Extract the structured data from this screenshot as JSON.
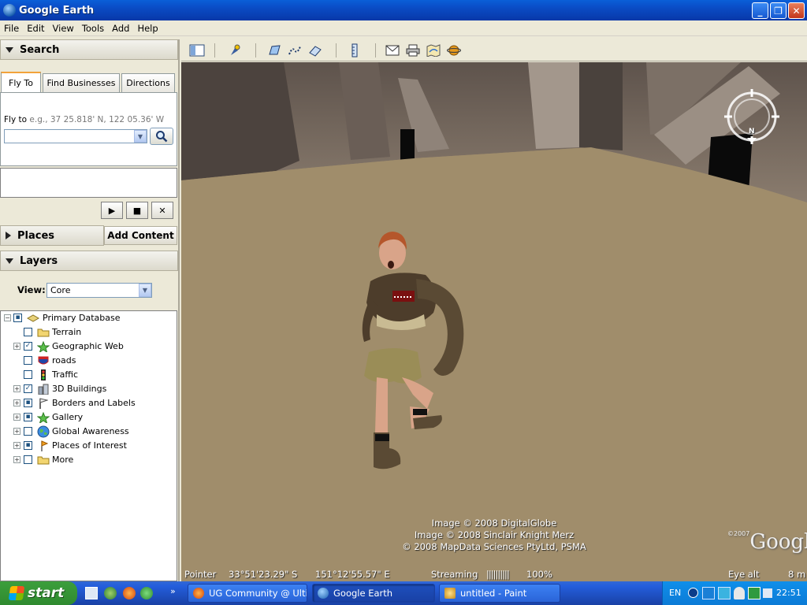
{
  "window": {
    "title": "Google Earth"
  },
  "menu": [
    "File",
    "Edit",
    "View",
    "Tools",
    "Add",
    "Help"
  ],
  "search": {
    "header": "Search",
    "tabs": [
      "Fly To",
      "Find Businesses",
      "Directions"
    ],
    "fly_to_label": "Fly to",
    "fly_to_example": "e.g., 37 25.818' N, 122 05.36' W",
    "fly_to_value": ""
  },
  "places": {
    "header": "Places",
    "add_content": "Add Content"
  },
  "layers": {
    "header": "Layers",
    "view_label": "View:",
    "view_value": "Core",
    "items": [
      {
        "label": "Primary Database",
        "checked": "partial",
        "expandable": true,
        "icon": "database-icon"
      },
      {
        "label": "Terrain",
        "checked": "unchecked",
        "expandable": false,
        "icon": "folder-icon"
      },
      {
        "label": "Geographic Web",
        "checked": "checked",
        "expandable": true,
        "icon": "star-icon"
      },
      {
        "label": "roads",
        "checked": "unchecked",
        "expandable": false,
        "icon": "road-sign-icon"
      },
      {
        "label": "Traffic",
        "checked": "unchecked",
        "expandable": false,
        "icon": "traffic-light-icon"
      },
      {
        "label": "3D Buildings",
        "checked": "checked",
        "expandable": true,
        "icon": "buildings-icon"
      },
      {
        "label": "Borders and Labels",
        "checked": "partial",
        "expandable": true,
        "icon": "flag-icon"
      },
      {
        "label": "Gallery",
        "checked": "partial",
        "expandable": true,
        "icon": "star-icon"
      },
      {
        "label": "Global Awareness",
        "checked": "unchecked",
        "expandable": true,
        "icon": "globe-icon"
      },
      {
        "label": "Places of Interest",
        "checked": "partial",
        "expandable": true,
        "icon": "pin-icon"
      },
      {
        "label": "More",
        "checked": "unchecked",
        "expandable": true,
        "icon": "folder-icon"
      }
    ]
  },
  "viewport": {
    "credits": [
      "Image © 2008 DigitalGlobe",
      "Image © 2008 Sinclair Knight Merz",
      "© 2008 MapData Sciences PtyLtd, PSMA"
    ],
    "logo_year": "©2007",
    "logo_text": "Google",
    "compass_label": "N"
  },
  "status": {
    "pointer_label": "Pointer",
    "lat": "33°51'23.29\" S",
    "lon": "151°12'55.57\" E",
    "streaming_label": "Streaming",
    "streaming_bar": "||||||||||",
    "streaming_pct": "100%",
    "eye_label": "Eye alt",
    "eye_value": "8 m"
  },
  "taskbar": {
    "start": "start",
    "tasks": [
      "UG Community @ Ulti...",
      "Google Earth",
      "untitled - Paint"
    ],
    "language": "EN",
    "clock": "22:51"
  },
  "colors": {
    "xp_blue": "#0a4bc4",
    "start_green": "#3c9e3c",
    "ground": "#a08d6b"
  }
}
